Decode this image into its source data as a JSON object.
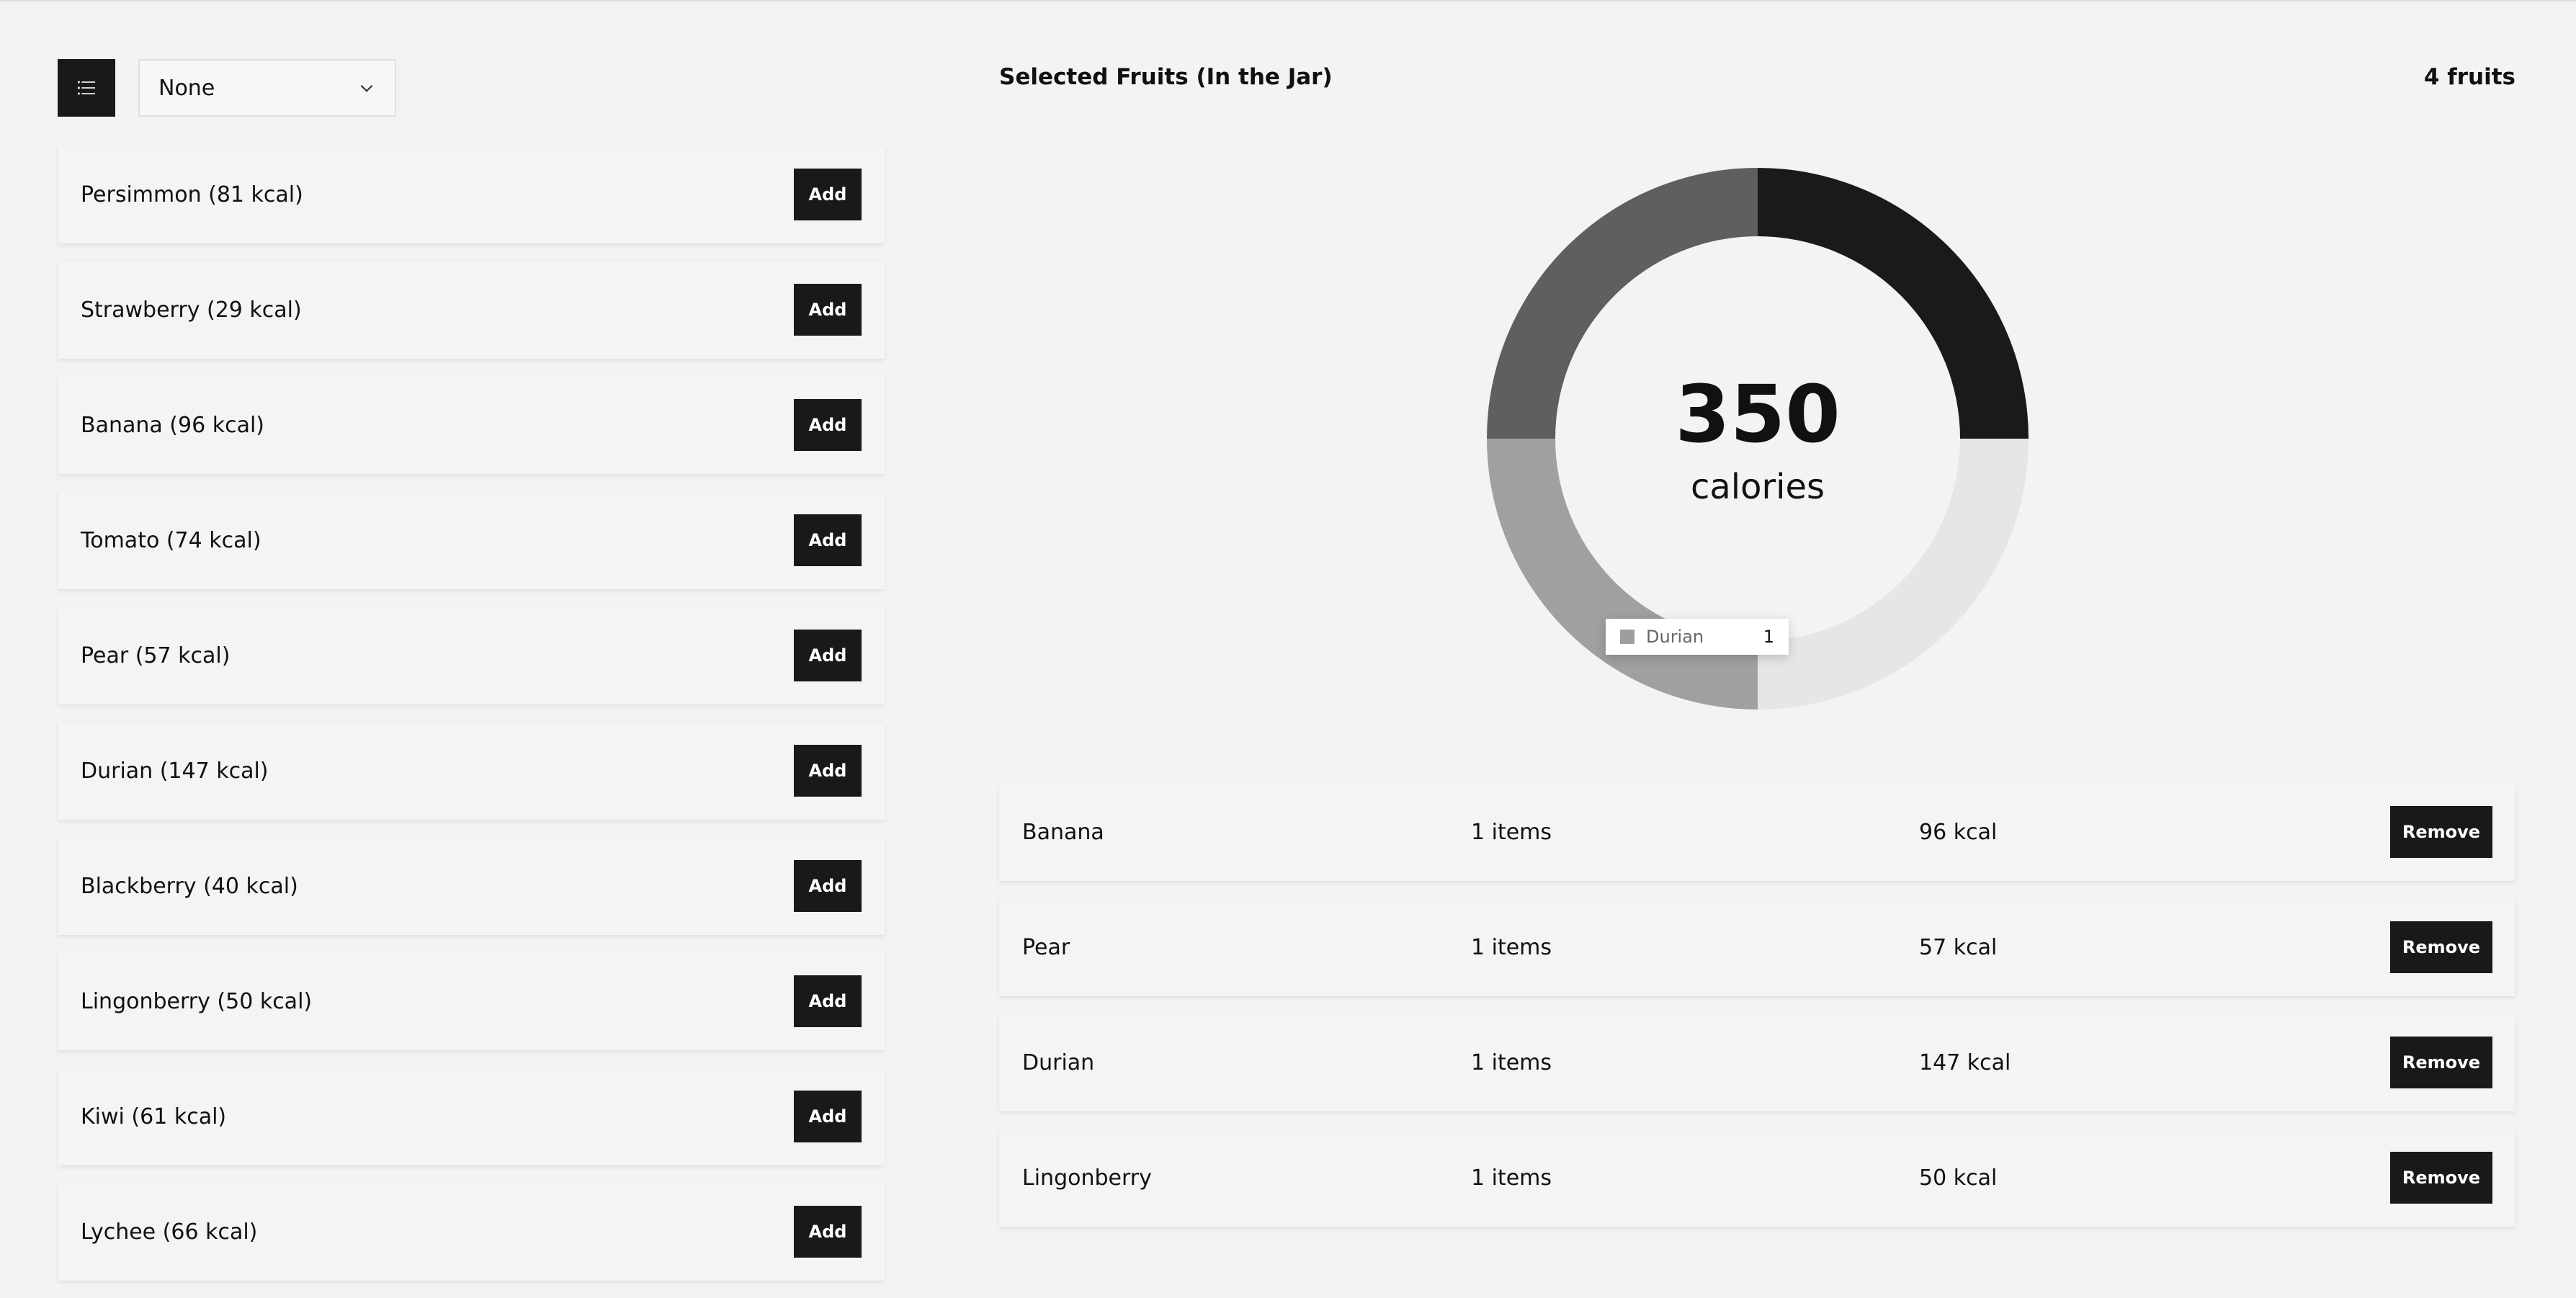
{
  "toolbar": {
    "list_icon": "list-icon",
    "sort_select": {
      "value": "None",
      "icon": "chevron-down-icon"
    }
  },
  "fruits": [
    {
      "label": "Persimmon (81 kcal)",
      "button": "Add"
    },
    {
      "label": "Strawberry (29 kcal)",
      "button": "Add"
    },
    {
      "label": "Banana (96 kcal)",
      "button": "Add"
    },
    {
      "label": "Tomato (74 kcal)",
      "button": "Add"
    },
    {
      "label": "Pear (57 kcal)",
      "button": "Add"
    },
    {
      "label": "Durian (147 kcal)",
      "button": "Add"
    },
    {
      "label": "Blackberry (40 kcal)",
      "button": "Add"
    },
    {
      "label": "Lingonberry (50 kcal)",
      "button": "Add"
    },
    {
      "label": "Kiwi (61 kcal)",
      "button": "Add"
    },
    {
      "label": "Lychee (66 kcal)",
      "button": "Add"
    }
  ],
  "jar": {
    "title": "Selected Fruits (In the Jar)",
    "count": "4 fruits",
    "total_calories": "350",
    "total_label": "calories",
    "tooltip": {
      "name": "Durian",
      "value": "1"
    },
    "selected": [
      {
        "name": "Banana",
        "items": "1 items",
        "kcal": "96 kcal",
        "button": "Remove"
      },
      {
        "name": "Pear",
        "items": "1 items",
        "kcal": "57 kcal",
        "button": "Remove"
      },
      {
        "name": "Durian",
        "items": "1 items",
        "kcal": "147 kcal",
        "button": "Remove"
      },
      {
        "name": "Lingonberry",
        "items": "1 items",
        "kcal": "50 kcal",
        "button": "Remove"
      }
    ]
  },
  "chart_data": {
    "type": "pie",
    "donut": true,
    "categories": [
      "Banana",
      "Pear",
      "Durian",
      "Lingonberry"
    ],
    "values": [
      1,
      1,
      1,
      1
    ],
    "colors": [
      "#1a1a1a",
      "#e6e6e6",
      "#a0a0a0",
      "#5f5f5f"
    ]
  }
}
